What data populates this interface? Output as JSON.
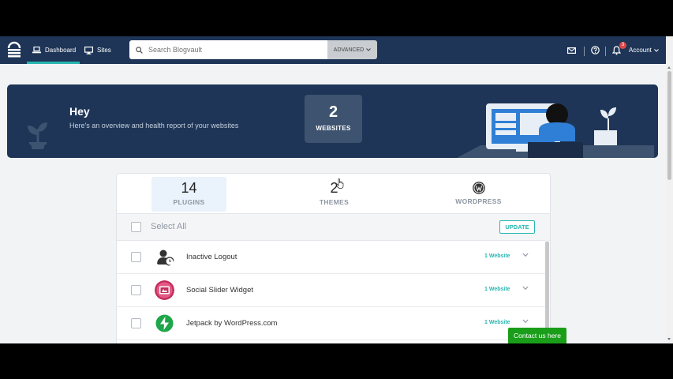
{
  "nav": {
    "dashboard": "Dashboard",
    "sites": "Sites",
    "search_placeholder": "Search Blogvault",
    "advanced": "ADVANCED",
    "notification_count": "3",
    "account": "Account"
  },
  "banner": {
    "greeting": "Hey",
    "subtitle": "Here's an overview and health report of your websites",
    "websites_count": "2",
    "websites_label": "WEBSITES"
  },
  "tabs": [
    {
      "count": "14",
      "label": "PLUGINS",
      "active": true
    },
    {
      "count": "2",
      "label": "THEMES",
      "active": false
    },
    {
      "icon": "wordpress-icon",
      "label": "WORDPRESS",
      "active": false
    }
  ],
  "list": {
    "select_all": "Select All",
    "update": "UPDATE",
    "rows": [
      {
        "name": "Inactive Logout",
        "count": "1 Website",
        "icon": "inactive-logout-icon"
      },
      {
        "name": "Social Slider Widget",
        "count": "1 Website",
        "icon": "social-slider-icon"
      },
      {
        "name": "Jetpack by WordPress.com",
        "count": "1 Website",
        "icon": "jetpack-icon"
      }
    ]
  },
  "contact": "Contact us here",
  "colors": {
    "nav_bg": "#1e3557",
    "accent": "#28b6b0",
    "contact_bg": "#1a9e1a",
    "badge": "#e04747"
  }
}
